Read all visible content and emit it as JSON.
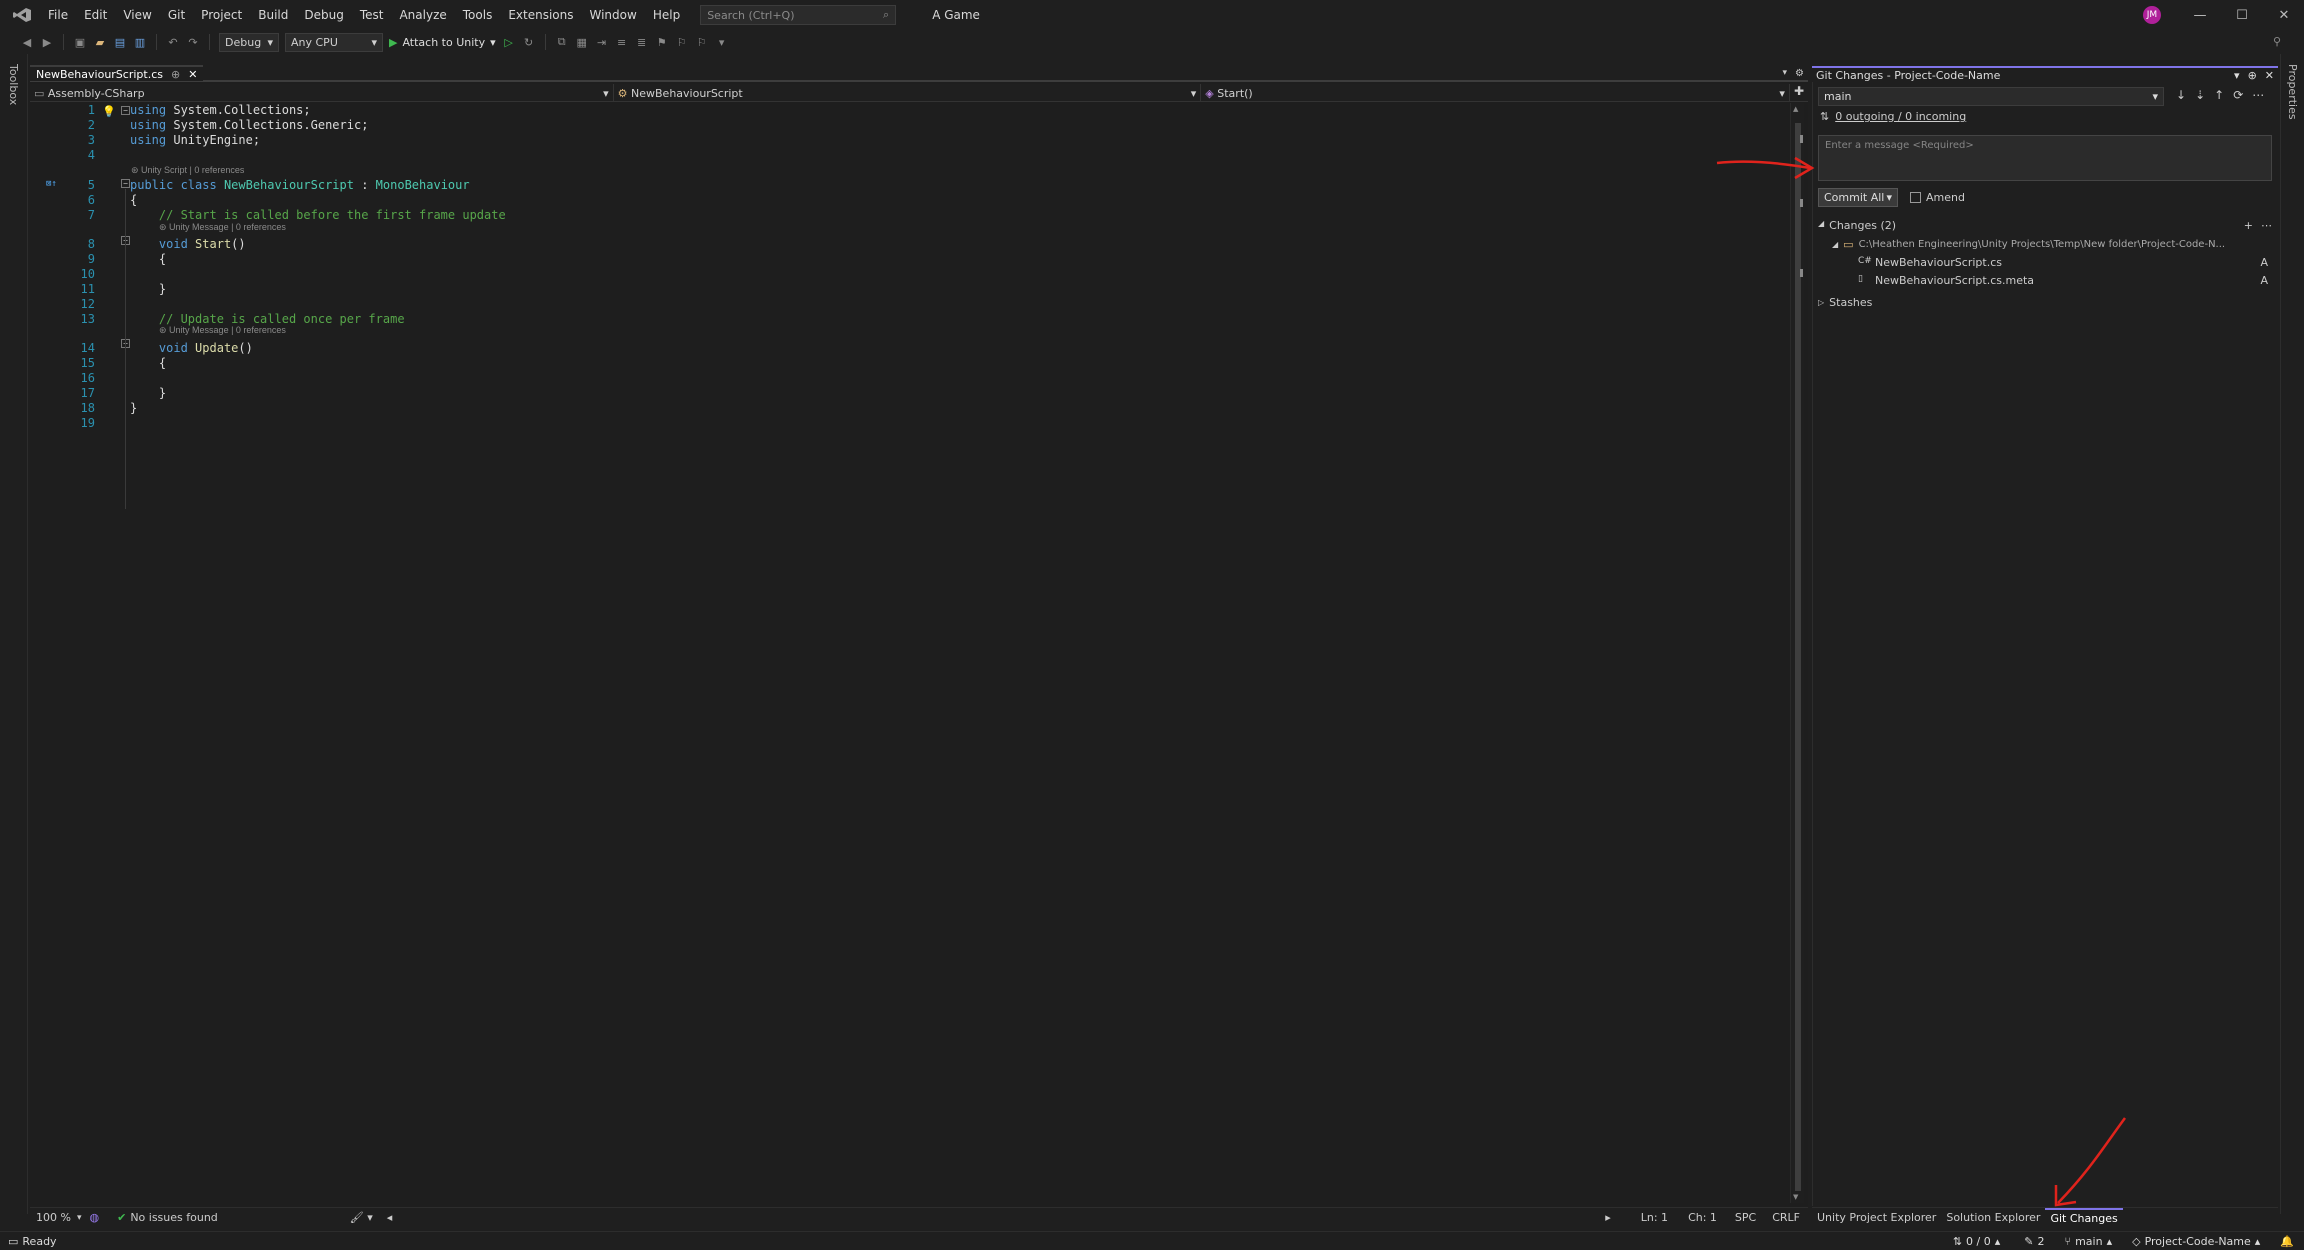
{
  "menu": [
    "File",
    "Edit",
    "View",
    "Git",
    "Project",
    "Build",
    "Debug",
    "Test",
    "Analyze",
    "Tools",
    "Extensions",
    "Window",
    "Help"
  ],
  "search": {
    "placeholder": "Search (Ctrl+Q)"
  },
  "solution_title": "A Game",
  "user_initials": "JM",
  "toolbar": {
    "config": "Debug",
    "platform": "Any CPU",
    "attach_label": "Attach to Unity"
  },
  "left_tool": "Toolbox",
  "right_tool": "Properties",
  "editor": {
    "tab_name": "NewBehaviourScript.cs",
    "nav": {
      "project": "Assembly-CSharp",
      "type": "NewBehaviourScript",
      "member": "Start()"
    },
    "lens": {
      "class": "Unity Script | 0 references",
      "start": "Unity Message | 0 references",
      "update": "Unity Message | 0 references"
    },
    "lines": [
      {
        "n": "1",
        "html": "<span class='kw'>using</span> System.Collections;"
      },
      {
        "n": "2",
        "html": "<span class='kw'>using</span> System.Collections.Generic;"
      },
      {
        "n": "3",
        "html": "<span class='kw'>using</span> UnityEngine;"
      },
      {
        "n": "4",
        "html": ""
      },
      {
        "n": "5",
        "html": "<span class='kw'>public class</span> <span class='ty'>NewBehaviourScript</span> : <span class='ty'>MonoBehaviour</span>"
      },
      {
        "n": "6",
        "html": "{"
      },
      {
        "n": "7",
        "html": "    <span class='cm'>// Start is called before the first frame update</span>"
      },
      {
        "n": "8",
        "html": "    <span class='kw'>void</span> <span class='fn'>Start</span>()"
      },
      {
        "n": "9",
        "html": "    {"
      },
      {
        "n": "10",
        "html": ""
      },
      {
        "n": "11",
        "html": "    }"
      },
      {
        "n": "12",
        "html": ""
      },
      {
        "n": "13",
        "html": "    <span class='cm'>// Update is called once per frame</span>"
      },
      {
        "n": "14",
        "html": "    <span class='kw'>void</span> <span class='fn'>Update</span>()"
      },
      {
        "n": "15",
        "html": "    {"
      },
      {
        "n": "16",
        "html": ""
      },
      {
        "n": "17",
        "html": "    }"
      },
      {
        "n": "18",
        "html": "}"
      },
      {
        "n": "19",
        "html": ""
      }
    ],
    "zoom": "100 %",
    "issues": "No issues found",
    "ln": "Ln: 1",
    "ch": "Ch: 1",
    "spc": "SPC",
    "crlf": "CRLF"
  },
  "git": {
    "title": "Git Changes - Project-Code-Name",
    "branch": "main",
    "sync": "0 outgoing / 0 incoming",
    "message_placeholder": "Enter a message <Required>",
    "commit_label": "Commit All",
    "amend_label": "Amend",
    "changes_label": "Changes (2)",
    "folder": "C:\\Heathen Engineering\\Unity Projects\\Temp\\New folder\\Project-Code-N...",
    "files": [
      {
        "name": "NewBehaviourScript.cs",
        "status": "A",
        "icon": "C#"
      },
      {
        "name": "NewBehaviourScript.cs.meta",
        "status": "A",
        "icon": ""
      }
    ],
    "stashes_label": "Stashes"
  },
  "bottom_tabs": [
    "Unity Project Explorer",
    "Solution Explorer",
    "Git Changes"
  ],
  "status": {
    "ready": "Ready",
    "sync": "0 / 0",
    "edits": "2",
    "branch": "main",
    "repo": "Project-Code-Name"
  },
  "colors": {
    "accent": "#7f74e8",
    "annotation": "#e0231c",
    "keyword": "#569cd6",
    "type": "#4ec9b0",
    "comment": "#57a64a"
  }
}
